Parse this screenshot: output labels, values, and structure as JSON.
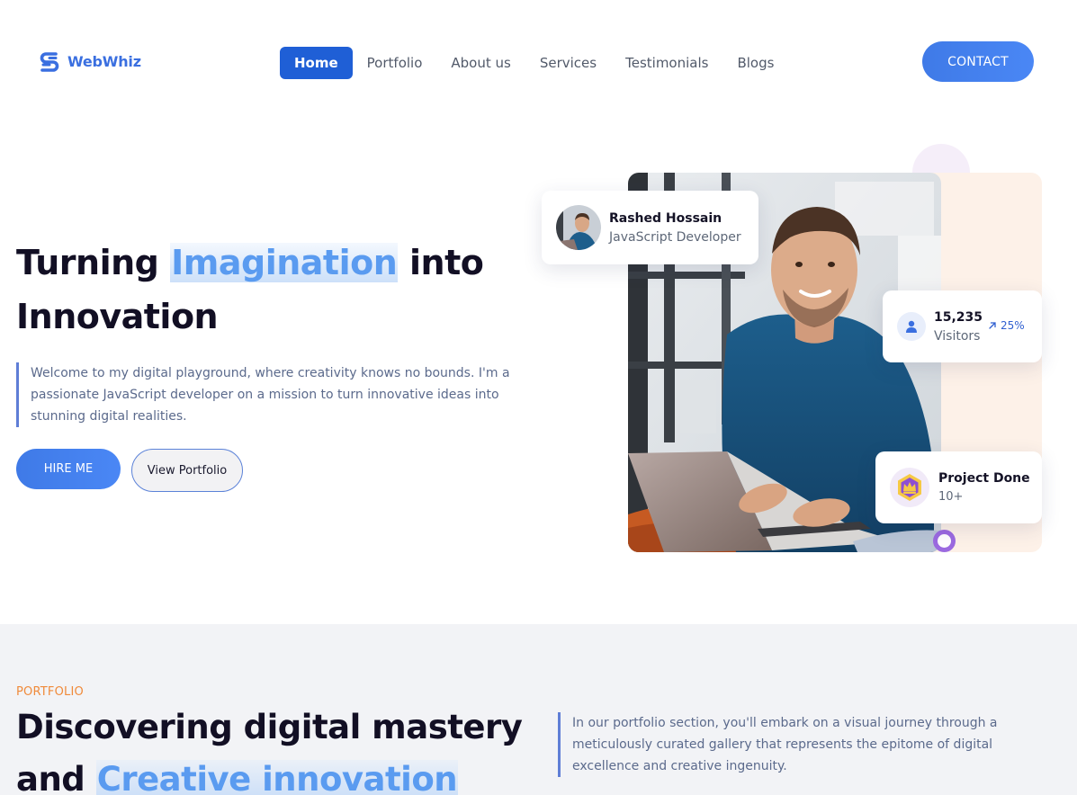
{
  "brand": {
    "name": "WebWhiz",
    "logo_icon": "s-swirl-logo-icon",
    "accent": "#3a6fe0"
  },
  "nav": {
    "items": [
      {
        "label": "Home",
        "active": true
      },
      {
        "label": "Portfolio"
      },
      {
        "label": "About us"
      },
      {
        "label": "Services"
      },
      {
        "label": "Testimonials"
      },
      {
        "label": "Blogs"
      }
    ],
    "contact_label": "CONTACT"
  },
  "hero": {
    "title_before": "Turning ",
    "title_highlight": "Imagination",
    "title_after": " into Innovation",
    "description": "Welcome to my digital playground, where creativity knows no bounds. I'm a passionate JavaScript developer on a mission to turn innovative ideas into stunning digital realities.",
    "primary_cta": "HIRE ME",
    "secondary_cta": "View Portfolio",
    "profile": {
      "name": "Rashed Hossain",
      "role": "JavaScript Developer"
    },
    "visitors": {
      "count": "15,235",
      "label": "Visitors",
      "trend": "25%",
      "icon": "user-icon",
      "trend_icon": "arrow-up-right-icon"
    },
    "projects": {
      "title": "Project Done",
      "count": "10+",
      "icon": "crown-badge-icon"
    }
  },
  "portfolio": {
    "tag": "PORTFOLIO",
    "title_line1": "Discovering digital mastery",
    "title_line2_before": "and ",
    "title_line2_highlight": "Creative innovation",
    "description": "In our portfolio section, you'll embark on a visual journey through a meticulously curated gallery that represents the epitome of digital excellence and creative ingenuity."
  },
  "colors": {
    "primary": "#1f5fd6",
    "button_gradient_start": "#3f7ae7",
    "button_gradient_end": "#4a87f5",
    "heading": "#120f24",
    "highlight_text": "#5a9bf0",
    "tag_orange": "#f08a3a",
    "section_bg": "#f2f3f6"
  }
}
